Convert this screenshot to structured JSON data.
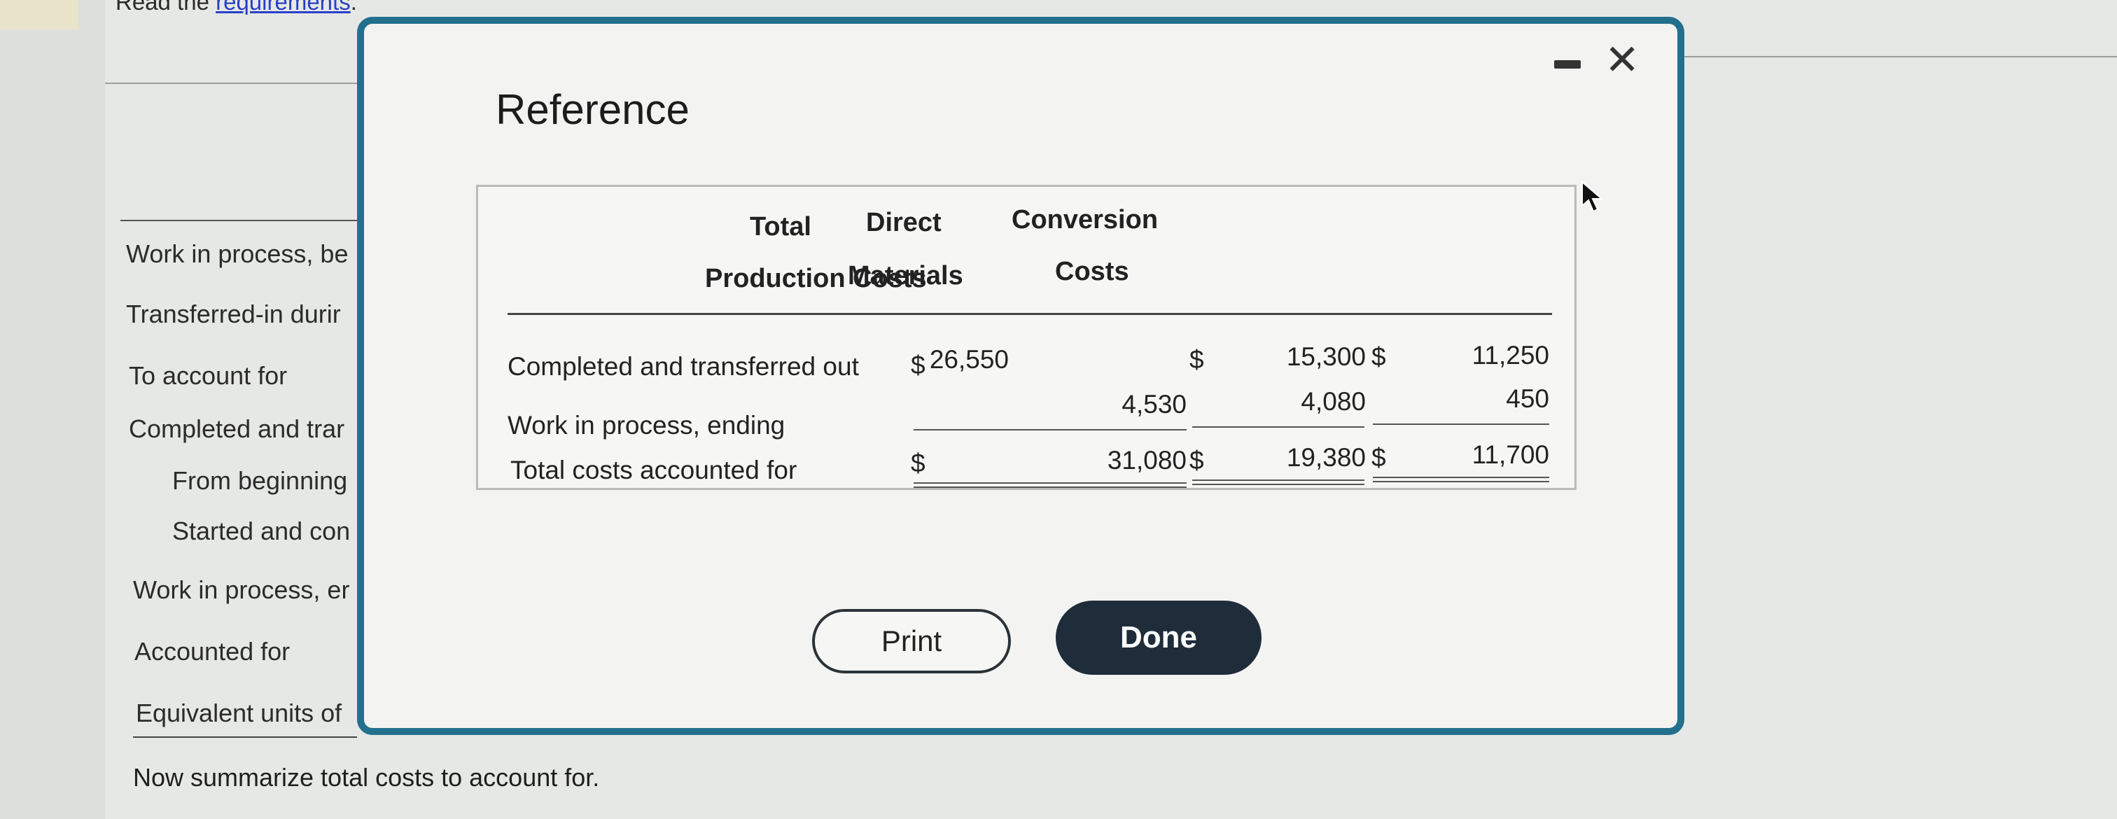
{
  "background": {
    "top_text_prefix": "Read the",
    "top_text_link": "requirements",
    "top_text_suffix": ".",
    "left_rows": [
      "Work in process, be",
      "Transferred-in durir",
      "To account for",
      "Completed and trar",
      "From beginning",
      "Started and con",
      "Work in process, er",
      "Accounted for",
      "Equivalent units of"
    ],
    "bottom_text": "Now summarize total costs to account for."
  },
  "modal": {
    "title": "Reference",
    "print_label": "Print",
    "done_label": "Done"
  },
  "table": {
    "headers": {
      "col1_line1": "Total",
      "col1_line2": "Production Costs",
      "col2_line1": "Direct",
      "col2_line2": "Materials",
      "col3_line1": "Conversion",
      "col3_line2": "Costs"
    },
    "rows": [
      {
        "label": "Completed and transferred out",
        "dollar1": "$",
        "total": "26,550",
        "dollar2": "$",
        "dm": "15,300",
        "dollar3": "$",
        "cc": "11,250"
      },
      {
        "label": "Work in process, ending",
        "total": "4,530",
        "dm": "4,080",
        "cc": "450"
      },
      {
        "label": "Total costs accounted for",
        "dollar1": "$",
        "total": "31,080",
        "dollar2": "$",
        "dm": "19,380",
        "dollar3": "$",
        "cc": "11,700"
      }
    ]
  }
}
